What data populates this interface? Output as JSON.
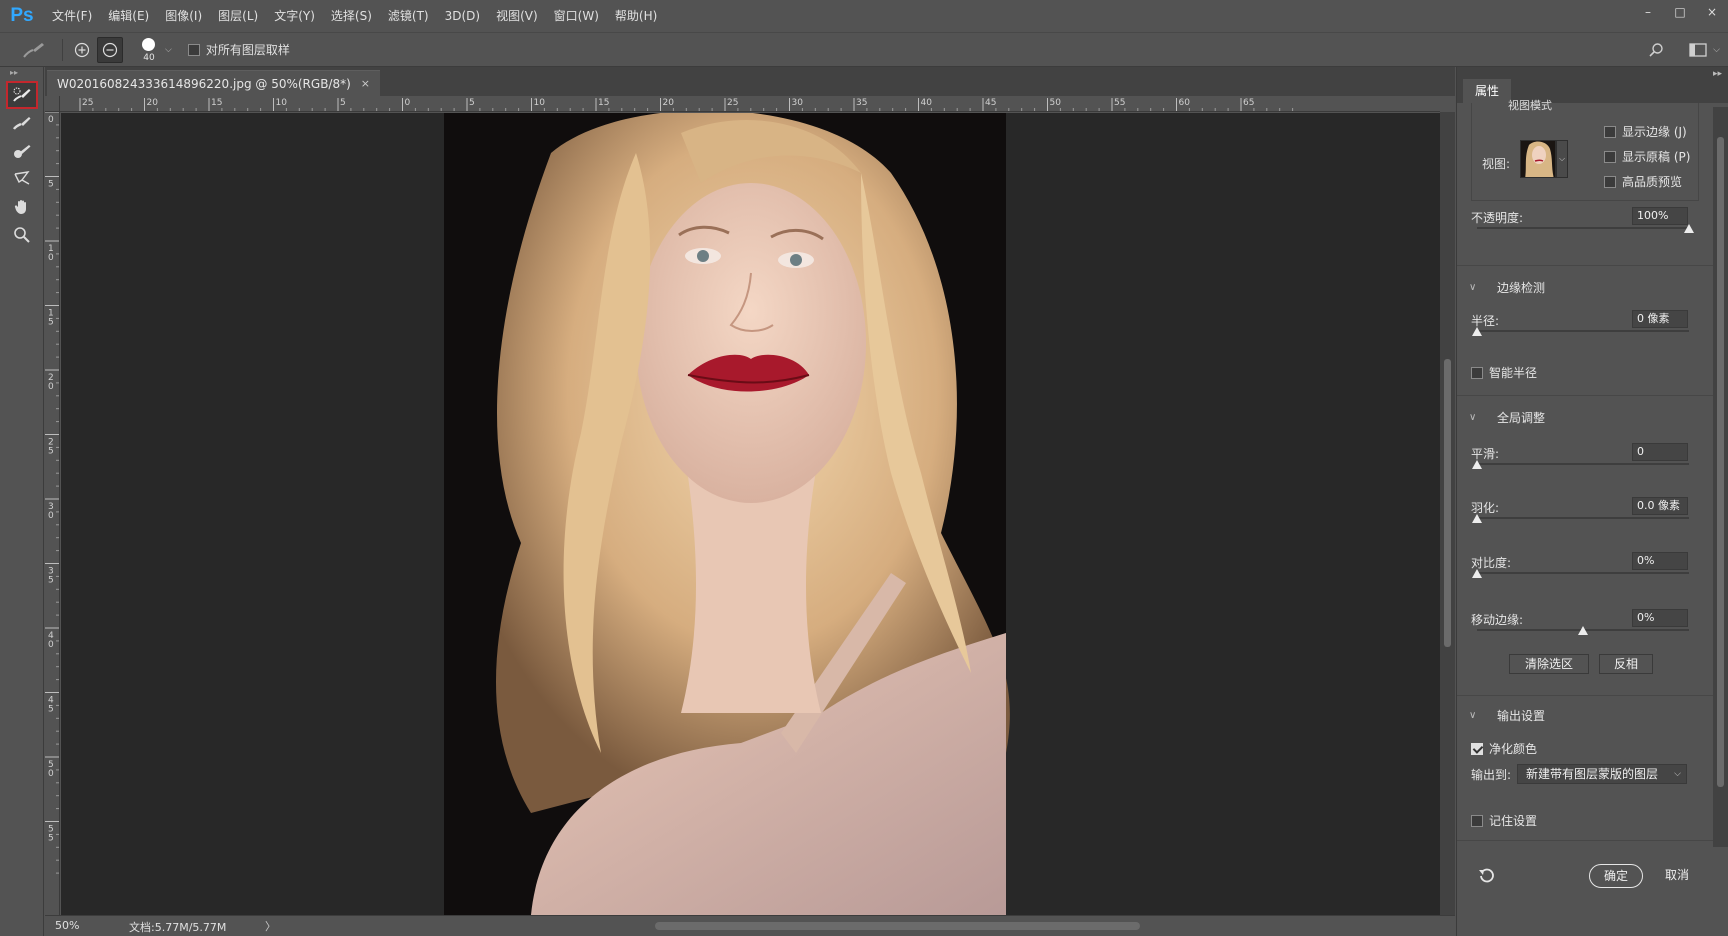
{
  "app": {
    "logo": "Ps"
  },
  "menu": [
    "文件(F)",
    "编辑(E)",
    "图像(I)",
    "图层(L)",
    "文字(Y)",
    "选择(S)",
    "滤镜(T)",
    "3D(D)",
    "视图(V)",
    "窗口(W)",
    "帮助(H)"
  ],
  "window_controls": {
    "minimize": "–",
    "maximize": "□",
    "close": "×"
  },
  "options": {
    "brush_size": "40",
    "sample_all_layers": "对所有图层取样",
    "sample_all_layers_checked": false
  },
  "document": {
    "tab_title": "W020160824333614896220.jpg @ 50%(RGB/8*)",
    "close": "×",
    "ruler_h_ticks": [
      "25",
      "20",
      "15",
      "10",
      "5",
      "0",
      "5",
      "10",
      "15",
      "20",
      "25",
      "30",
      "35",
      "40",
      "45",
      "50",
      "55",
      "60",
      "65"
    ],
    "ruler_v_ticks": [
      "0",
      "5",
      "1 0",
      "1 5",
      "2 0",
      "2 5",
      "3 0",
      "3 5",
      "4 0",
      "4 5",
      "5 0",
      "5 5"
    ]
  },
  "status": {
    "zoom": "50%",
    "doc_info": "文档:5.77M/5.77M",
    "arrow": "〉"
  },
  "panel": {
    "tab": "属性",
    "view_mode_cut": "视图模式",
    "view_label": "视图:",
    "show_edge": "显示边缘 (J)",
    "show_original": "显示原稿 (P)",
    "hq_preview": "高品质预览",
    "opacity_label": "不透明度:",
    "opacity_value": "100%",
    "opacity_level": 1.0,
    "edge_detection": "边缘检测",
    "radius_label": "半径:",
    "radius_value": "0 像素",
    "smart_radius": "智能半径",
    "global_refine": "全局调整",
    "smooth_label": "平滑:",
    "smooth_value": "0",
    "feather_label": "羽化:",
    "feather_value": "0.0 像素",
    "contrast_label": "对比度:",
    "contrast_value": "0%",
    "shift_edge_label": "移动边缘:",
    "shift_edge_value": "0%",
    "clear_selection": "清除选区",
    "invert": "反相",
    "output_settings": "输出设置",
    "decontaminate": "净化颜色",
    "decontaminate_checked": true,
    "output_to_label": "输出到:",
    "output_to_value": "新建带有图层蒙版的图层",
    "remember": "记住设置",
    "ok": "确定",
    "cancel": "取消"
  },
  "colors": {
    "ps_blue": "#31a8ff",
    "active_tool_border": "#c4272d"
  }
}
